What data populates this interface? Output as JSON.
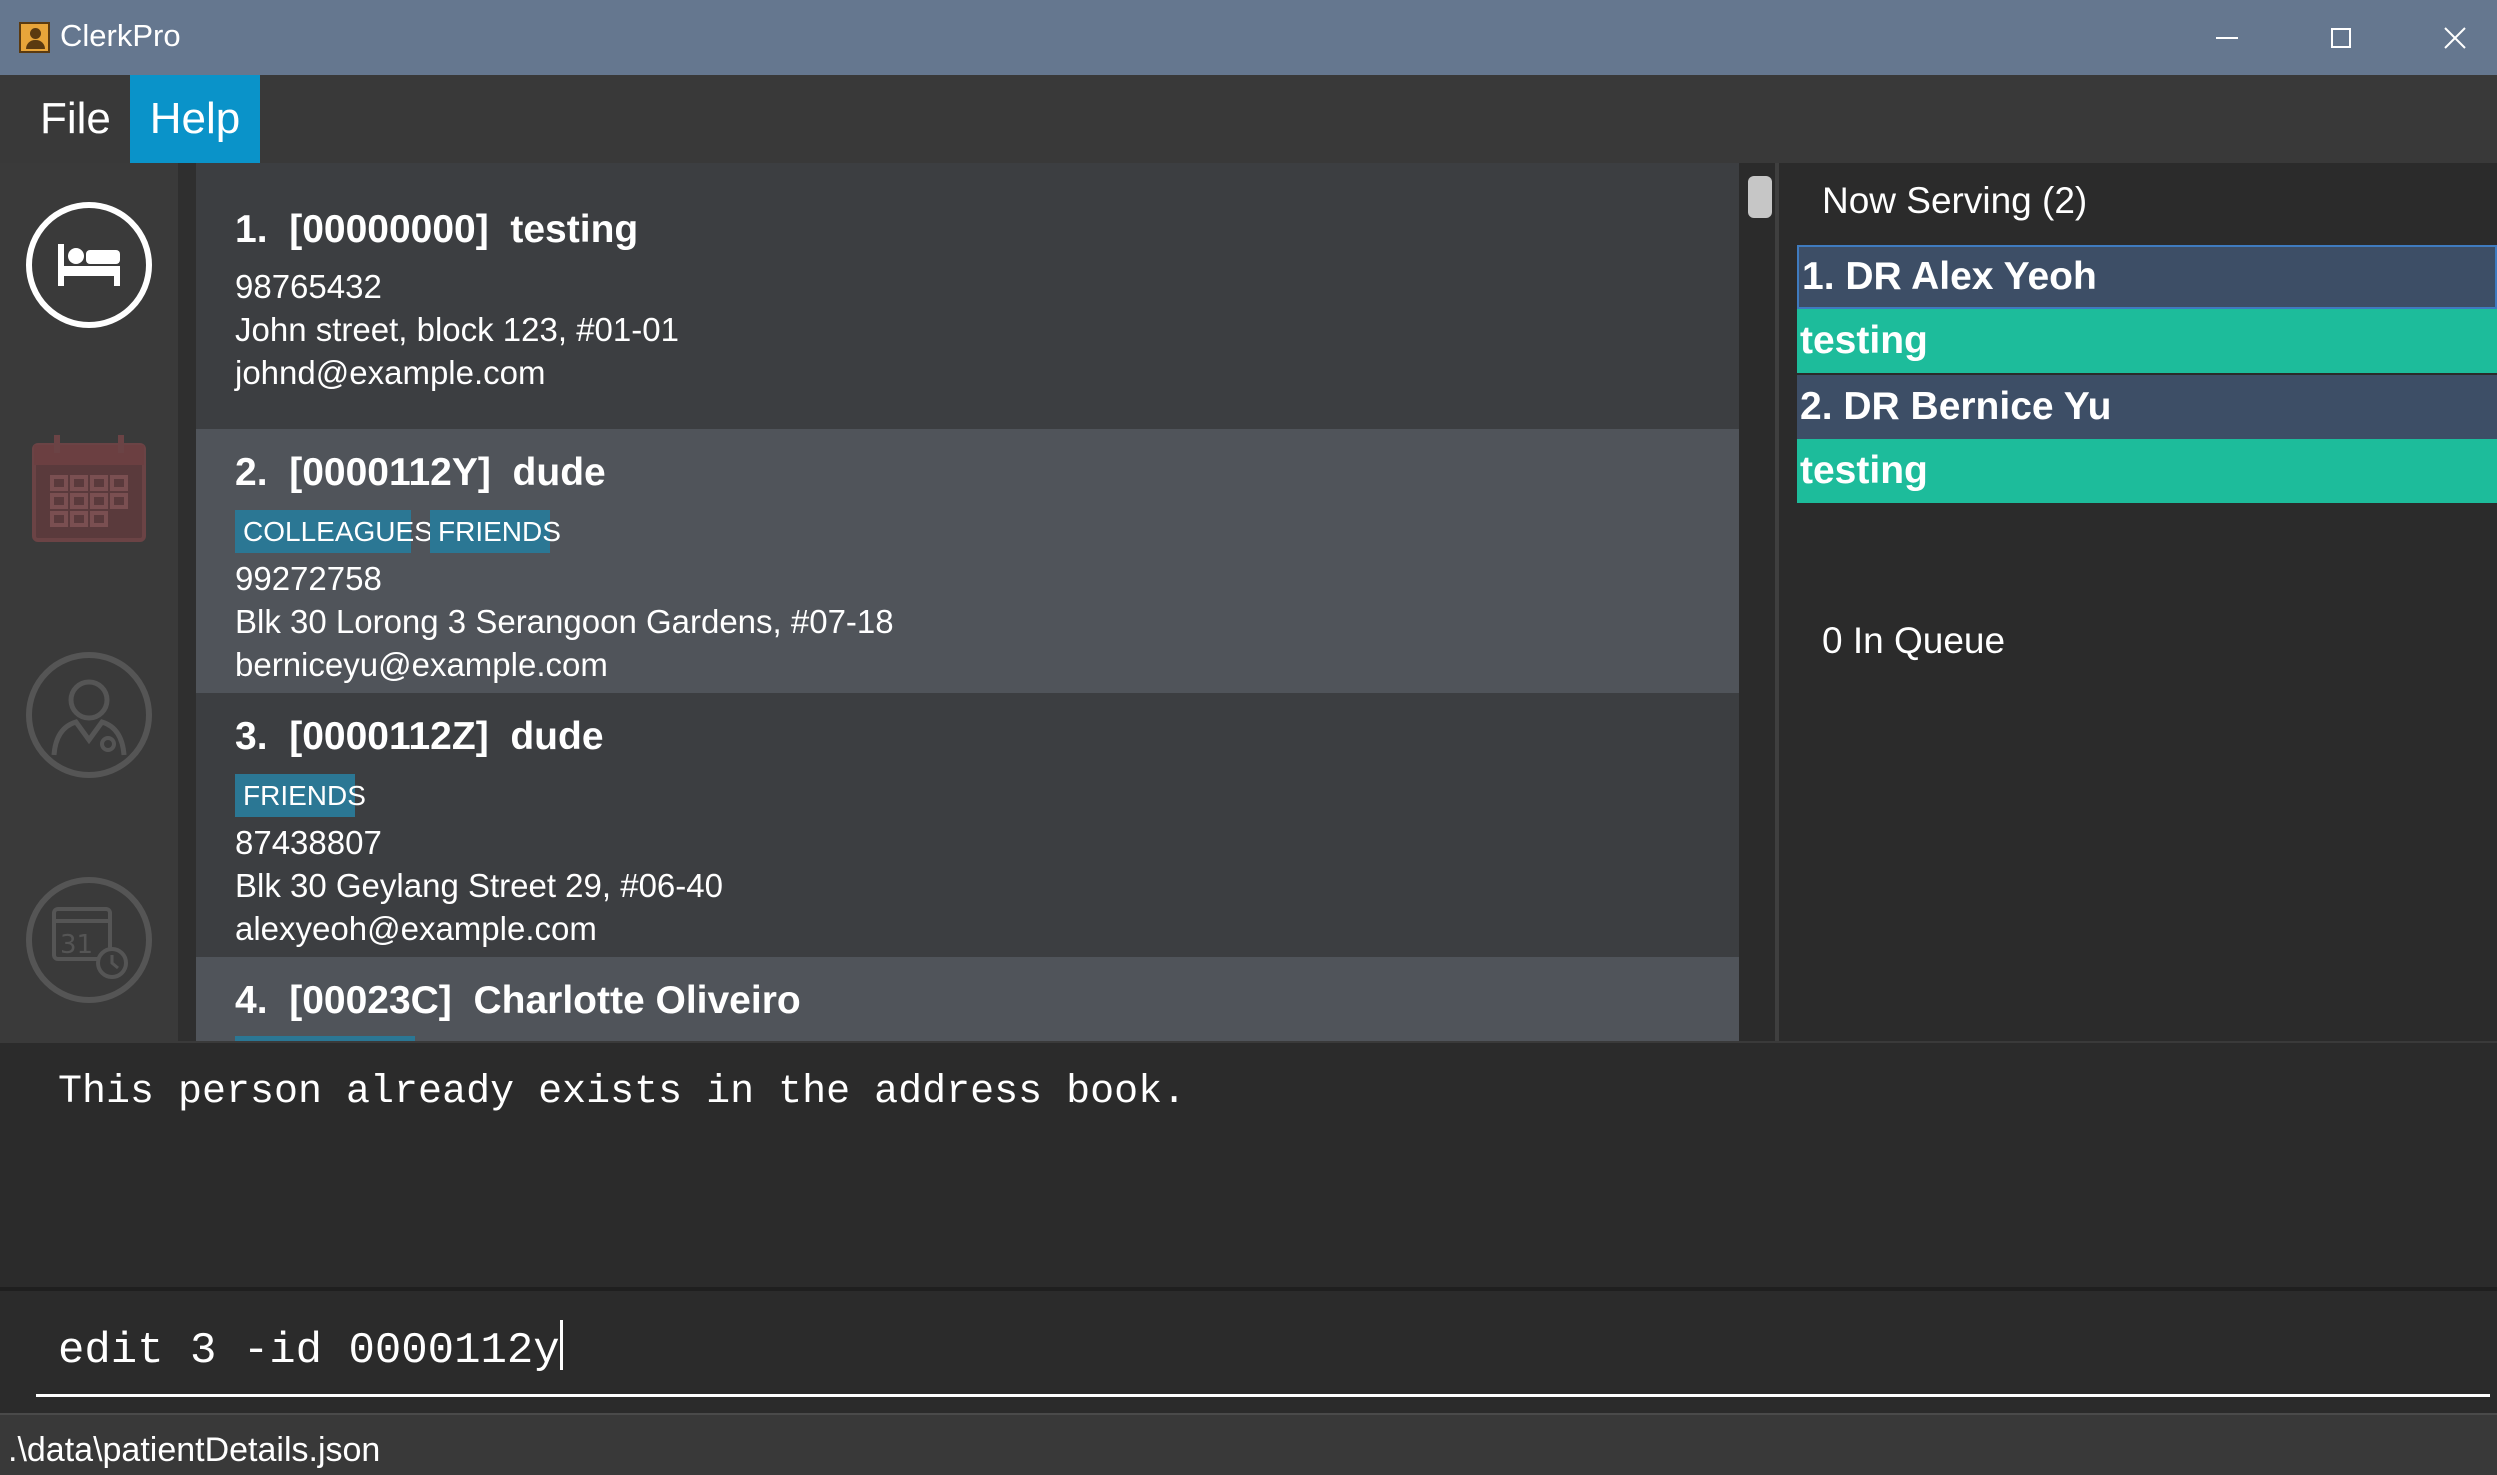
{
  "window": {
    "title": "ClerkPro"
  },
  "menu": {
    "file": "File",
    "help": "Help"
  },
  "patients": [
    {
      "index": "1.",
      "id": "[00000000]",
      "name": "testing",
      "tags": [],
      "phone": "98765432",
      "address": "John street, block 123, #01-01",
      "email": "johnd@example.com"
    },
    {
      "index": "2.",
      "id": "[0000112Y]",
      "name": "dude",
      "tags": [
        "COLLEAGUES",
        "FRIENDS"
      ],
      "phone": "99272758",
      "address": "Blk 30 Lorong 3 Serangoon Gardens, #07-18",
      "email": "berniceyu@example.com"
    },
    {
      "index": "3.",
      "id": "[0000112Z]",
      "name": "dude",
      "tags": [
        "FRIENDS"
      ],
      "phone": "87438807",
      "address": "Blk 30 Geylang Street 29, #06-40",
      "email": "alexyeoh@example.com"
    },
    {
      "index": "4.",
      "id": "[00023C]",
      "name": "Charlotte Oliveiro"
    }
  ],
  "queue": {
    "now_serving_label": "Now Serving (2)",
    "serving": [
      {
        "doctor": "1. DR Alex Yeoh",
        "patient": "testing"
      },
      {
        "doctor": "2. DR Bernice Yu",
        "patient": "testing"
      }
    ],
    "in_queue_label": "0 In Queue"
  },
  "result": {
    "message": "This person already exists in the address book."
  },
  "command": {
    "value": "edit 3 -id 0000112y"
  },
  "status": {
    "file_path": ".\\data\\patientDetails.json"
  },
  "colors": {
    "accent_help": "#0a93c9",
    "doctor_row": "#3d4e66",
    "patient_row": "#1dbc9b",
    "tag": "#2b7794",
    "titlebar": "#65778f"
  },
  "icons": [
    "patients-icon",
    "calendar-icon",
    "doctor-icon",
    "appointments-icon",
    "close-icon",
    "minimize-icon",
    "maximize-icon"
  ]
}
